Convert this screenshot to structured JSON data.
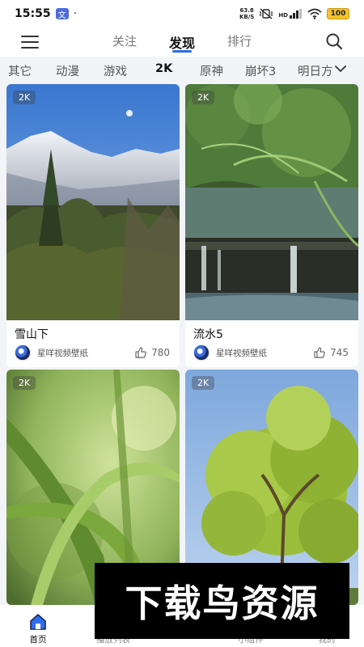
{
  "status_bar": {
    "time": "15:55",
    "app_icon_text": "文",
    "dot": "·",
    "net_speed_value": "63.8",
    "net_speed_unit": "KB/S",
    "hd_label": "HD",
    "battery": "100"
  },
  "header": {
    "tabs": [
      {
        "label": "关注"
      },
      {
        "label": "发现",
        "active": true
      },
      {
        "label": "排行"
      }
    ]
  },
  "categories": {
    "items": [
      "其它",
      "动漫",
      "游戏",
      "2K",
      "原神",
      "崩坏3"
    ],
    "active": "2K",
    "more_label": "明日方"
  },
  "cards": [
    {
      "badge": "2K",
      "title": "雪山下",
      "author": "星咩视频壁纸",
      "likes": "780"
    },
    {
      "badge": "2K",
      "title": "流水5",
      "author": "星咩视频壁纸",
      "likes": "745"
    },
    {
      "badge": "2K",
      "title": "",
      "author": "",
      "likes": ""
    },
    {
      "badge": "2K",
      "title": "",
      "author": "",
      "likes": ""
    }
  ],
  "bottom_nav": {
    "items": [
      {
        "label": "首页",
        "icon": "home-icon",
        "active": true
      },
      {
        "label": "播放列表",
        "icon": "playlist-icon"
      },
      {
        "label": "小组件",
        "icon": "widget-icon"
      },
      {
        "label": "我的",
        "icon": "profile-icon"
      }
    ]
  },
  "watermark": {
    "text": "下载鸟资源"
  },
  "colors": {
    "accent": "#2f6cf0",
    "background": "#f3f4f7",
    "battery": "#f3c22d"
  }
}
